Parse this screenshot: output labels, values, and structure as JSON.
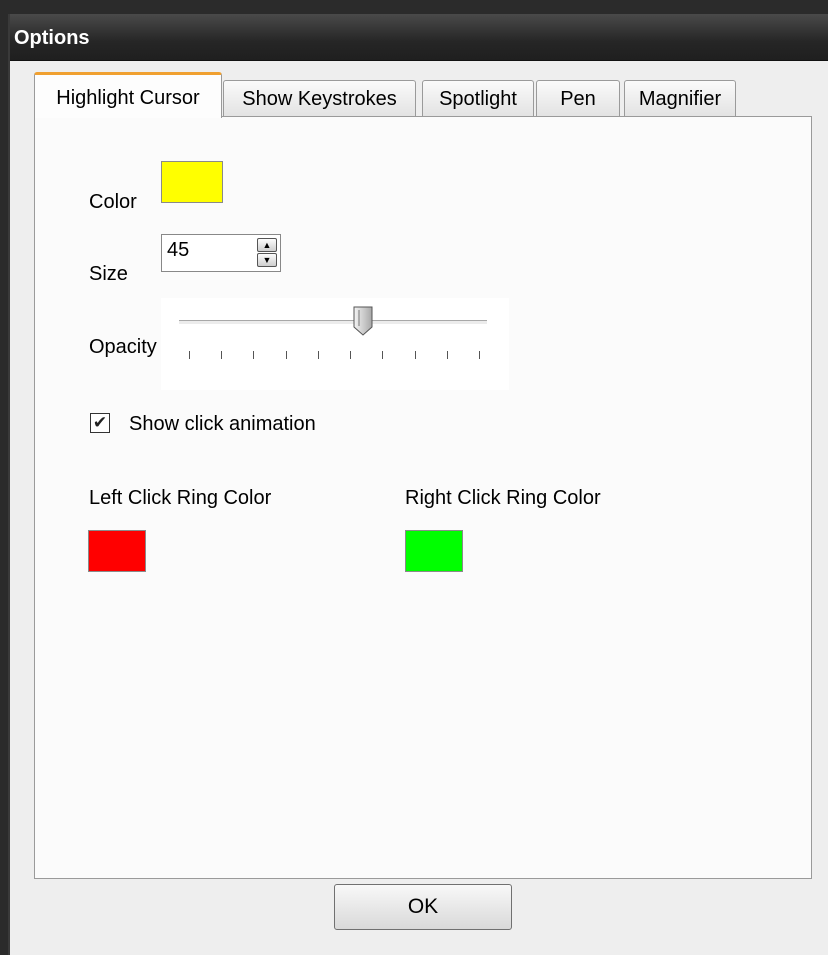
{
  "window": {
    "title": "Options"
  },
  "tabs": [
    {
      "label": "Highlight Cursor",
      "active": true
    },
    {
      "label": "Show Keystrokes",
      "active": false
    },
    {
      "label": "Spotlight",
      "active": false
    },
    {
      "label": "Pen",
      "active": false
    },
    {
      "label": "Magnifier",
      "active": false
    }
  ],
  "highlight": {
    "color_label": "Color",
    "color_value": "#ffff00",
    "size_label": "Size",
    "size_value": "45",
    "opacity_label": "Opacity",
    "opacity_level": 0.6,
    "opacity_tick_count": 10,
    "show_click_animation_label": "Show click animation",
    "show_click_animation_checked": true,
    "left_click_label": "Left Click Ring Color",
    "left_click_color": "#ff0000",
    "right_click_label": "Right Click Ring Color",
    "right_click_color": "#00ff00"
  },
  "footer": {
    "ok_label": "OK"
  },
  "icons": {
    "check": "✔",
    "spin_up": "▲",
    "spin_down": "▼"
  }
}
